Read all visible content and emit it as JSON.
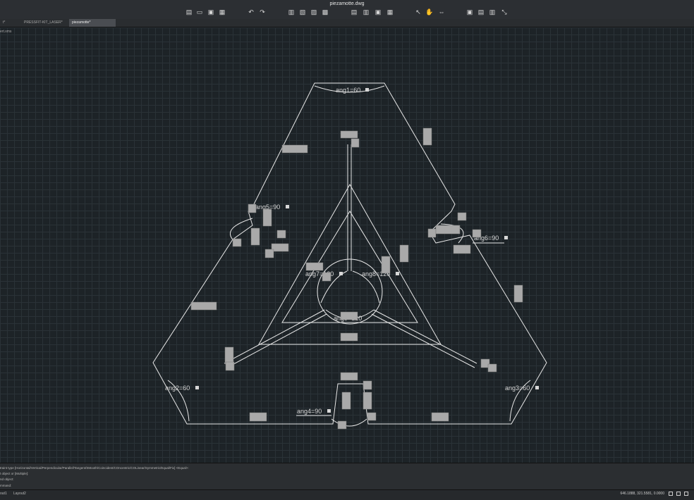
{
  "window": {
    "title": "piezamotte.dwg"
  },
  "toolbar": {
    "groups": [
      {
        "name": "file",
        "icons": [
          "new-icon",
          "open-icon",
          "save-icon",
          "save-as-icon"
        ]
      },
      {
        "name": "history",
        "icons": [
          "undo-icon",
          "redo-icon"
        ]
      },
      {
        "name": "print",
        "icons": [
          "print-icon",
          "print-preview-icon",
          "export-icon",
          "copy-icon"
        ]
      },
      {
        "name": "clipboard",
        "icons": [
          "cut-icon",
          "copy-doc-icon",
          "paste-icon",
          "paste-special-icon"
        ]
      },
      {
        "name": "view",
        "icons": [
          "select-icon",
          "pan-hand-icon",
          "zoom-icon"
        ]
      },
      {
        "name": "panels",
        "icons": [
          "panel-1-icon",
          "panel-2-icon",
          "panel-3-icon",
          "panel-4-icon"
        ]
      }
    ]
  },
  "tabs": [
    {
      "label": "t*",
      "active": false
    },
    {
      "label": "PRESSFIT-KIT_LASER*",
      "active": false
    },
    {
      "label": "piezamotte*",
      "active": true
    }
  ],
  "drawing": {
    "corner_label": "ert.xms",
    "dimensions": [
      {
        "label": "ang1=60"
      },
      {
        "label": "ang5=90"
      },
      {
        "label": "ang6=90"
      },
      {
        "label": "ang7=120"
      },
      {
        "label": "ang8=120"
      },
      {
        "label": "ang9=120"
      },
      {
        "label": "ang2=60"
      },
      {
        "label": "ang3=60"
      },
      {
        "label": "ang4=90"
      }
    ],
    "line_color": "#e8e8e8",
    "background_color": "#1d2327",
    "constraint_badge_color": "#a9a9a9"
  },
  "command": {
    "lines": [
      "traint type [Horizontal/Vertical/Perpendicular/Parallel/Tangent/SMooth/Coincident/COncentric/COLinear/Symmetric/Equal/Fix] <Equal>:",
      "t object or [Multiple]:",
      "nd object:",
      "mmand:"
    ]
  },
  "status": {
    "layout_tabs": [
      "out1",
      "Layout2"
    ],
    "coordinates": "646.1888, 321.5581, 0.0000"
  }
}
